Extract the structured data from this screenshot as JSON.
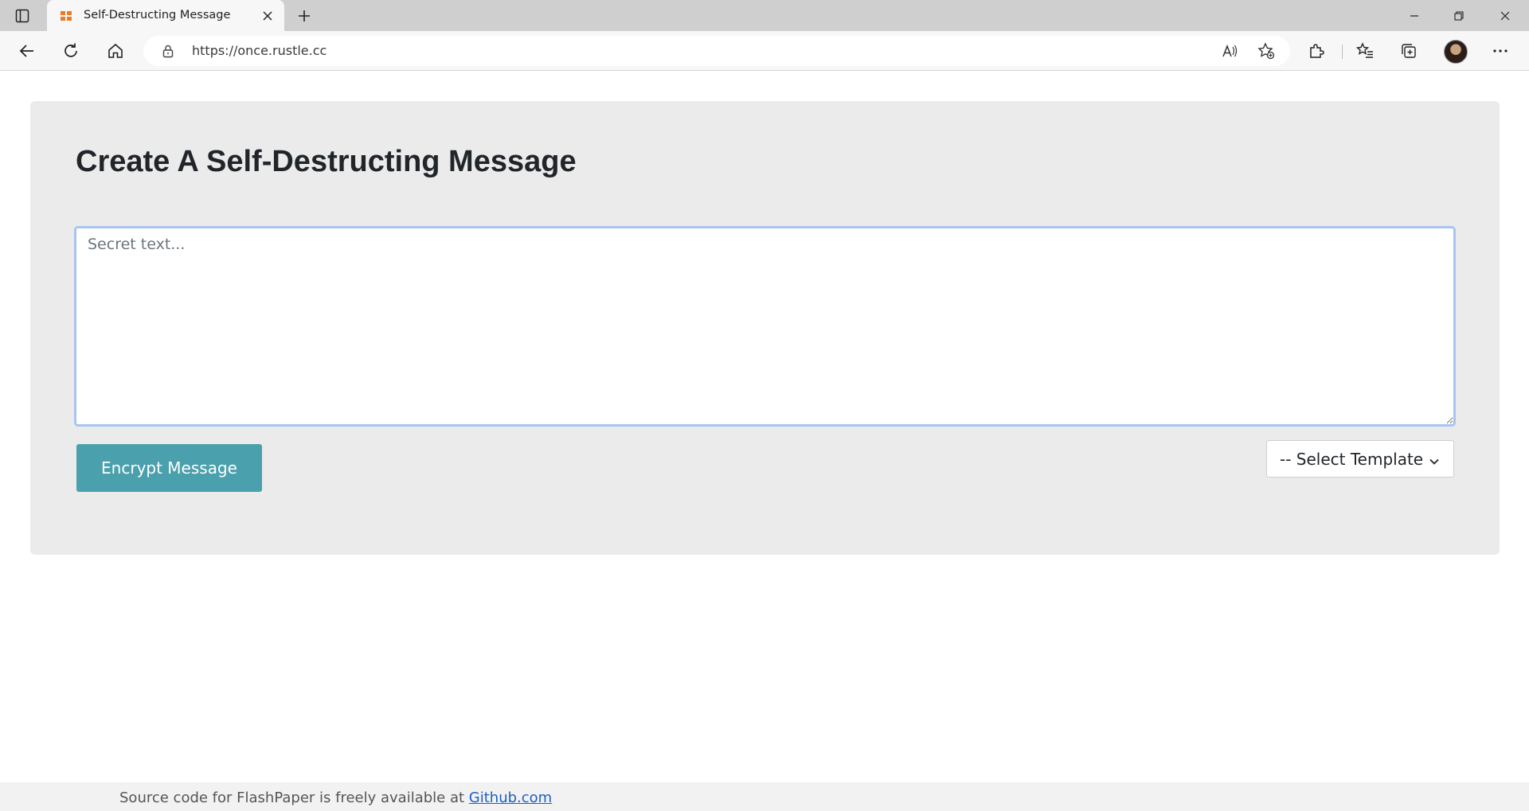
{
  "browser": {
    "tab": {
      "title": "Self-Destructing Message"
    },
    "address": {
      "url": "https://once.rustle.cc"
    }
  },
  "page": {
    "title": "Create A Self-Destructing Message",
    "secret_placeholder": "Secret text...",
    "encrypt_label": "Encrypt Message",
    "template_select": {
      "selected": "-- Select Template"
    },
    "accent_color": "#4aa0ac"
  },
  "footer": {
    "text": "Source code for FlashPaper is freely available at",
    "link_label": "Github.com"
  }
}
